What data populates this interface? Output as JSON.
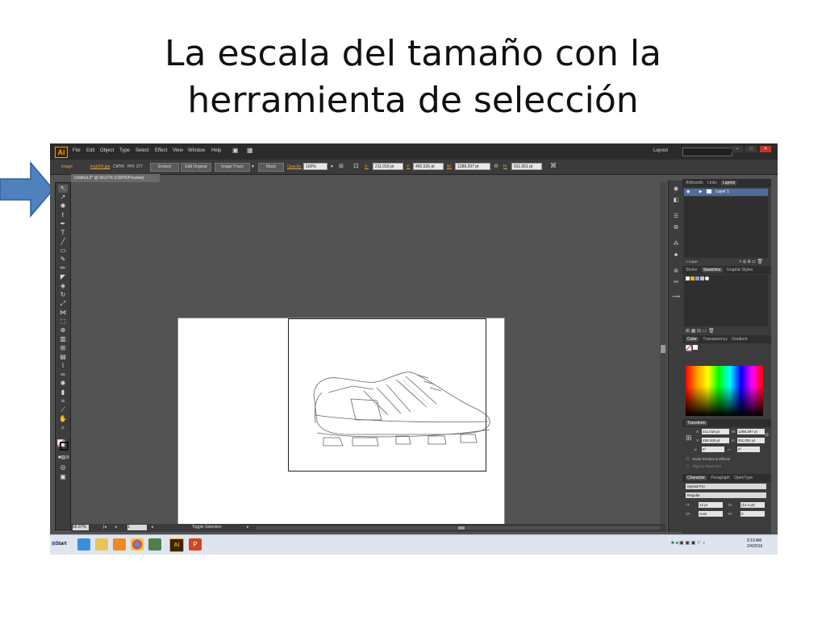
{
  "slide": {
    "title_line1": "La escala del tamaño con la",
    "title_line2": "herramienta de selección"
  },
  "app": {
    "logo": "Ai",
    "menus": [
      "File",
      "Edit",
      "Object",
      "Type",
      "Select",
      "Effect",
      "View",
      "Window",
      "Help"
    ],
    "layout_label": "Layout",
    "window_controls": [
      "–",
      "□",
      "✕"
    ]
  },
  "control_bar": {
    "object_type": "Image",
    "file_name": "img093.jpg",
    "color_mode": "CMYK",
    "ppi": "PPI: 277",
    "embed": "Embed",
    "edit_original": "Edit Original",
    "image_trace": "Image Trace",
    "mask": "Mask",
    "opacity_label": "Opacity:",
    "opacity_value": "100%",
    "x_label": "X:",
    "x_value": "211.016 pt",
    "y_label": "Y:",
    "y_value": "455.526 pt",
    "w_label": "W:",
    "w_value": "1288.297 pt",
    "h_label": "H:",
    "h_value": "911.051 pt"
  },
  "document": {
    "tab_title": "Untitled-2* @ 66.67% (CMYK/Preview)",
    "zoom": "66.67%",
    "page": "1",
    "status": "Toggle Selection"
  },
  "panels": {
    "layers_tabs": [
      "Artboards",
      "Links",
      "Layers"
    ],
    "layer_name": "Layer 1",
    "layers_count": "1 Layer",
    "swatch_tabs": [
      "Stroke",
      "Swatches",
      "Graphic Styles"
    ],
    "color_tabs": [
      "Color",
      "Transparency",
      "Gradient"
    ],
    "transform_title": "Transform",
    "transform": {
      "x": "211.016 pt",
      "y": "455.526 pt",
      "w": "1288.297 pt",
      "h": "911.051 pt",
      "angle": "0°",
      "shear": "0°",
      "scale_strokes": "Scale Strokes & Effects",
      "align_pixel": "Align to Pixel Grid"
    },
    "char_tabs": [
      "Character",
      "Paragraph",
      "OpenType"
    ],
    "font_family": "Myriad Pro",
    "font_style": "Regular",
    "font_size": "12 pt",
    "leading": "(14.4 pt)",
    "kerning": "Auto",
    "tracking": "0"
  },
  "taskbar": {
    "start": "Start",
    "time": "9:19 AM",
    "date": "2/4/2016"
  },
  "colors": {
    "arrow": "#4f81bd",
    "ui_dark": "#535353",
    "accent_ai": "#f7a300"
  }
}
